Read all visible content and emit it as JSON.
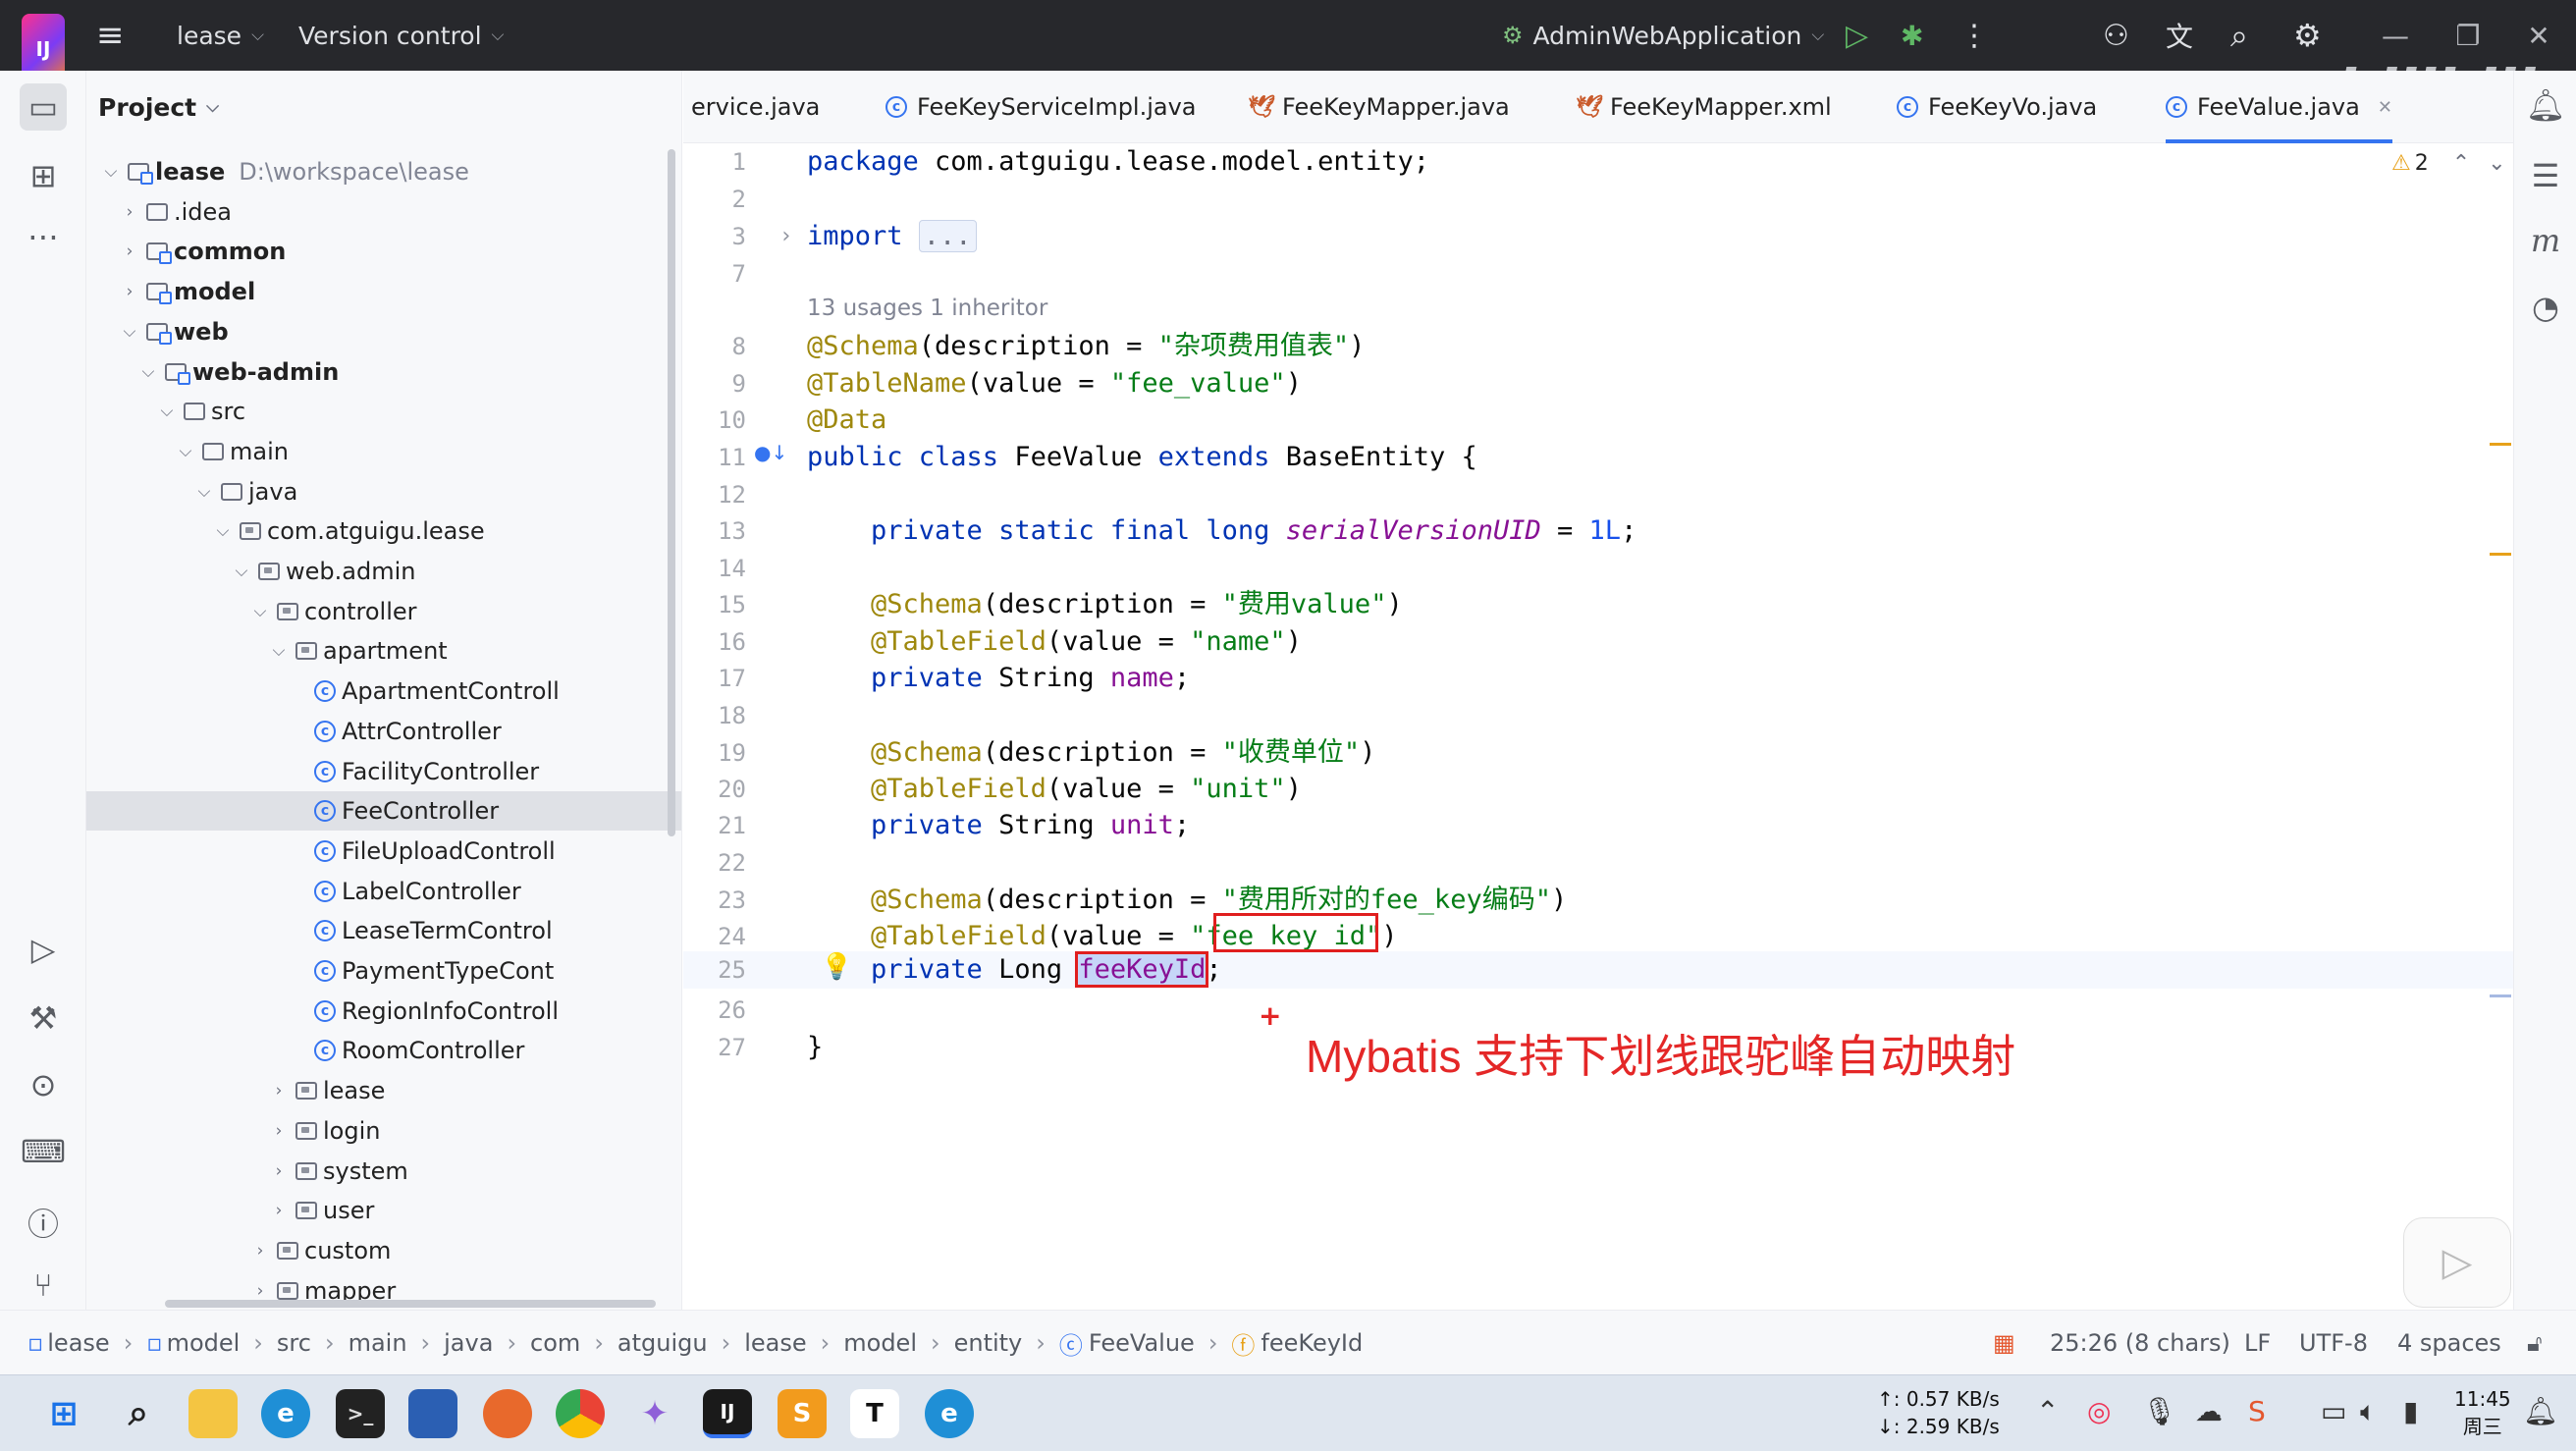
{
  "topbar": {
    "project": "lease",
    "vcs": "Version control",
    "run_config": "AdminWebApplication"
  },
  "project_panel": {
    "title": "Project",
    "root_name": "lease",
    "root_path": "D:\\workspace\\lease",
    "items": [
      {
        "label": "lease",
        "depth": 0,
        "arrow": "v",
        "icon": "mod"
      },
      {
        "label": ".idea",
        "depth": 1,
        "arrow": ">",
        "icon": "folder"
      },
      {
        "label": "common",
        "depth": 1,
        "arrow": ">",
        "icon": "mod"
      },
      {
        "label": "model",
        "depth": 1,
        "arrow": ">",
        "icon": "mod"
      },
      {
        "label": "web",
        "depth": 1,
        "arrow": "v",
        "icon": "mod"
      },
      {
        "label": "web-admin",
        "depth": 2,
        "arrow": "v",
        "icon": "mod"
      },
      {
        "label": "src",
        "depth": 3,
        "arrow": "v",
        "icon": "folder"
      },
      {
        "label": "main",
        "depth": 4,
        "arrow": "v",
        "icon": "folder"
      },
      {
        "label": "java",
        "depth": 5,
        "arrow": "v",
        "icon": "folder"
      },
      {
        "label": "com.atguigu.lease",
        "depth": 6,
        "arrow": "v",
        "icon": "pkg"
      },
      {
        "label": "web.admin",
        "depth": 7,
        "arrow": "v",
        "icon": "pkg"
      },
      {
        "label": "controller",
        "depth": 8,
        "arrow": "v",
        "icon": "pkg"
      },
      {
        "label": "apartment",
        "depth": 9,
        "arrow": "v",
        "icon": "pkg"
      },
      {
        "label": "ApartmentControll",
        "depth": 10,
        "arrow": "",
        "icon": "class"
      },
      {
        "label": "AttrController",
        "depth": 10,
        "arrow": "",
        "icon": "class"
      },
      {
        "label": "FacilityController",
        "depth": 10,
        "arrow": "",
        "icon": "class"
      },
      {
        "label": "FeeController",
        "depth": 10,
        "arrow": "",
        "icon": "class",
        "selected": true
      },
      {
        "label": "FileUploadControll",
        "depth": 10,
        "arrow": "",
        "icon": "class"
      },
      {
        "label": "LabelController",
        "depth": 10,
        "arrow": "",
        "icon": "class"
      },
      {
        "label": "LeaseTermControl",
        "depth": 10,
        "arrow": "",
        "icon": "class"
      },
      {
        "label": "PaymentTypeCont",
        "depth": 10,
        "arrow": "",
        "icon": "class"
      },
      {
        "label": "RegionInfoControll",
        "depth": 10,
        "arrow": "",
        "icon": "class"
      },
      {
        "label": "RoomController",
        "depth": 10,
        "arrow": "",
        "icon": "class"
      },
      {
        "label": "lease",
        "depth": 9,
        "arrow": ">",
        "icon": "pkg"
      },
      {
        "label": "login",
        "depth": 9,
        "arrow": ">",
        "icon": "pkg"
      },
      {
        "label": "system",
        "depth": 9,
        "arrow": ">",
        "icon": "pkg"
      },
      {
        "label": "user",
        "depth": 9,
        "arrow": ">",
        "icon": "pkg"
      },
      {
        "label": "custom",
        "depth": 8,
        "arrow": ">",
        "icon": "pkg"
      },
      {
        "label": "mapper",
        "depth": 8,
        "arrow": ">",
        "icon": "pkg"
      }
    ]
  },
  "tabs": [
    {
      "label": "ervice.java",
      "icon": "none"
    },
    {
      "label": "FeeKeyServiceImpl.java",
      "icon": "class"
    },
    {
      "label": "FeeKeyMapper.java",
      "icon": "bird"
    },
    {
      "label": "FeeKeyMapper.xml",
      "icon": "bird"
    },
    {
      "label": "FeeKeyVo.java",
      "icon": "class"
    },
    {
      "label": "FeeValue.java",
      "icon": "class",
      "active": true
    }
  ],
  "editor": {
    "warnings": "2",
    "usages_hint": "13 usages    1 inheritor",
    "lines": [
      {
        "n": "1",
        "tokens": [
          {
            "t": "package ",
            "c": "kw"
          },
          {
            "t": "com.atguigu.lease.model.entity;",
            "c": ""
          }
        ]
      },
      {
        "n": "2",
        "tokens": []
      },
      {
        "n": "3",
        "tokens": [
          {
            "t": "import ",
            "c": "kw"
          },
          {
            "t": "...",
            "c": "fold"
          }
        ]
      },
      {
        "n": "7",
        "tokens": []
      },
      {
        "n": "8",
        "tokens": [
          {
            "t": "@Schema",
            "c": "an"
          },
          {
            "t": "(description = ",
            "c": ""
          },
          {
            "t": "\"杂项费用值表\"",
            "c": "st"
          },
          {
            "t": ")",
            "c": ""
          }
        ]
      },
      {
        "n": "9",
        "tokens": [
          {
            "t": "@TableName",
            "c": "an"
          },
          {
            "t": "(value = ",
            "c": ""
          },
          {
            "t": "\"fee_value\"",
            "c": "st"
          },
          {
            "t": ")",
            "c": ""
          }
        ]
      },
      {
        "n": "10",
        "tokens": [
          {
            "t": "@Data",
            "c": "an"
          }
        ]
      },
      {
        "n": "11",
        "tokens": [
          {
            "t": "public class ",
            "c": "kw"
          },
          {
            "t": "FeeValue ",
            "c": ""
          },
          {
            "t": "extends ",
            "c": "kw"
          },
          {
            "t": "BaseEntity {",
            "c": ""
          }
        ]
      },
      {
        "n": "12",
        "tokens": []
      },
      {
        "n": "13",
        "tokens": [
          {
            "t": "    private static final long ",
            "c": "kw"
          },
          {
            "t": "serialVersionUID",
            "c": "ital"
          },
          {
            "t": " = ",
            "c": ""
          },
          {
            "t": "1L",
            "c": "num"
          },
          {
            "t": ";",
            "c": ""
          }
        ]
      },
      {
        "n": "14",
        "tokens": []
      },
      {
        "n": "15",
        "tokens": [
          {
            "t": "    @Schema",
            "c": "an"
          },
          {
            "t": "(description = ",
            "c": ""
          },
          {
            "t": "\"费用value\"",
            "c": "st"
          },
          {
            "t": ")",
            "c": ""
          }
        ]
      },
      {
        "n": "16",
        "tokens": [
          {
            "t": "    @TableField",
            "c": "an"
          },
          {
            "t": "(value = ",
            "c": ""
          },
          {
            "t": "\"name\"",
            "c": "st"
          },
          {
            "t": ")",
            "c": ""
          }
        ]
      },
      {
        "n": "17",
        "tokens": [
          {
            "t": "    private ",
            "c": "kw"
          },
          {
            "t": "String ",
            "c": ""
          },
          {
            "t": "name",
            "c": "fld"
          },
          {
            "t": ";",
            "c": ""
          }
        ]
      },
      {
        "n": "18",
        "tokens": []
      },
      {
        "n": "19",
        "tokens": [
          {
            "t": "    @Schema",
            "c": "an"
          },
          {
            "t": "(description = ",
            "c": ""
          },
          {
            "t": "\"收费单位\"",
            "c": "st"
          },
          {
            "t": ")",
            "c": ""
          }
        ]
      },
      {
        "n": "20",
        "tokens": [
          {
            "t": "    @TableField",
            "c": "an"
          },
          {
            "t": "(value = ",
            "c": ""
          },
          {
            "t": "\"unit\"",
            "c": "st"
          },
          {
            "t": ")",
            "c": ""
          }
        ]
      },
      {
        "n": "21",
        "tokens": [
          {
            "t": "    private ",
            "c": "kw"
          },
          {
            "t": "String ",
            "c": ""
          },
          {
            "t": "unit",
            "c": "fld"
          },
          {
            "t": ";",
            "c": ""
          }
        ]
      },
      {
        "n": "22",
        "tokens": []
      },
      {
        "n": "23",
        "tokens": [
          {
            "t": "    @Schema",
            "c": "an"
          },
          {
            "t": "(description = ",
            "c": ""
          },
          {
            "t": "\"费用所对的fee_key编码\"",
            "c": "st"
          },
          {
            "t": ")",
            "c": ""
          }
        ]
      },
      {
        "n": "24",
        "tokens": [
          {
            "t": "    @TableField",
            "c": "an"
          },
          {
            "t": "(value = ",
            "c": ""
          },
          {
            "t": "\"fee_key_id\"",
            "c": "st"
          },
          {
            "t": ")",
            "c": ""
          }
        ]
      },
      {
        "n": "25",
        "tokens": [
          {
            "t": "    private ",
            "c": "kw"
          },
          {
            "t": "Long ",
            "c": ""
          },
          {
            "t": "feeKeyId",
            "c": "fld sel-word"
          },
          {
            "t": ";",
            "c": ""
          }
        ]
      },
      {
        "n": "26",
        "tokens": []
      },
      {
        "n": "27",
        "tokens": [
          {
            "t": "}",
            "c": ""
          }
        ]
      }
    ]
  },
  "annotation": "Mybatis 支持下划线跟驼峰自动映射",
  "statusbar": {
    "breadcrumbs": [
      "lease",
      "model",
      "src",
      "main",
      "java",
      "com",
      "atguigu",
      "lease",
      "model",
      "entity",
      "FeeValue",
      "feeKeyId"
    ],
    "position": "25:26 (8 chars)",
    "line_sep": "LF",
    "encoding": "UTF-8",
    "indent": "4 spaces"
  },
  "taskbar": {
    "net_up": "↑: 0.57 KB/s",
    "net_down": "↓: 2.59 KB/s",
    "time": "11:45",
    "day": "周三"
  },
  "colors": {
    "accent": "#3574f0",
    "annotation_red": "#e42727",
    "topbar_bg": "#27282c"
  }
}
